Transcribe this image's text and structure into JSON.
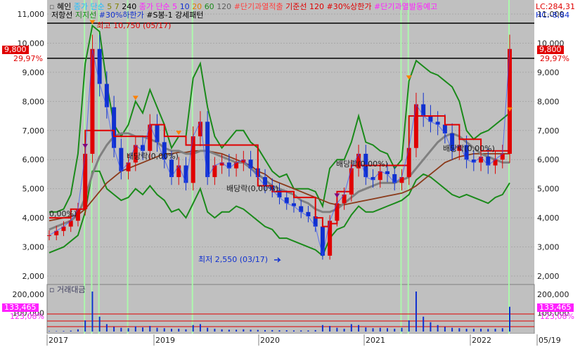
{
  "colors": {
    "plot_bg": "#c0c0c0",
    "main_line": "#e00000",
    "band": "#1a8a1a",
    "ma_slow": "#8b3a1a",
    "ma_gray": "#808080",
    "candle_up": "#e00000",
    "candle_down": "#1030d0",
    "volume_bar": "#1030d0",
    "price_tag": "#e00000",
    "volume_tag": "#ff20ff",
    "highlight_line": "#aaffaa",
    "resistance": "#000000"
  },
  "header": {
    "name": "혜인",
    "ma_prefix": "종가 단순",
    "ma_periods": [
      "5",
      "7",
      "240"
    ],
    "ma2_prefix": "종가 단순 5",
    "ma2_periods": [
      "10",
      "20",
      "60",
      "120"
    ],
    "signal1": "#단기과열적출",
    "baseline": "기준선 120",
    "signal2": "#30%상한가",
    "signal3": "#단기과열발동예고",
    "lc": "LC:284,31",
    "hc": "HC:-8,84"
  },
  "header2": {
    "resistance": "저항선",
    "support": "지지선",
    "signal4": "#30%하한가",
    "signal5": "#S봉-1 강세패턴"
  },
  "price_tag": {
    "value": "9,800",
    "pct": "29,97%"
  },
  "volume_panel": {
    "title": "거래대금",
    "tag_value": "133,465",
    "tag_pct": "123,08%",
    "axis_ticks": [
      "200,000",
      "100,000"
    ]
  },
  "y_ticks": [
    "11,000",
    "10,000",
    "9,000",
    "8,000",
    "7,000",
    "6,000",
    "5,000",
    "4,000",
    "3,000",
    "2,000"
  ],
  "x_ticks": [
    "2017",
    "2019",
    "2020",
    "2021",
    "2022",
    "05/19"
  ],
  "annotations": {
    "high": "최고 10,750 (05/17)",
    "low": "최저 2,550 (03/17)",
    "div1": "배당락(0,00%)",
    "div2": "배당락(0,00%)",
    "div3": "배당락(0,00%)",
    "div4": "배당락(0,00%)",
    "div0": "0,00%)"
  },
  "chart_data": {
    "type": "line",
    "title": "혜인",
    "y_unit": "KRW",
    "ylim": [
      2000,
      11000
    ],
    "x": [
      "2017-01",
      "2017-02",
      "2017-03",
      "2017-04",
      "2017-05",
      "2017-06",
      "2017-07",
      "2017-08",
      "2017-09",
      "2017-10",
      "2017-11",
      "2017-12",
      "2018-01",
      "2018-02",
      "2018-03",
      "2018-04",
      "2018-05",
      "2018-06",
      "2018-07",
      "2018-08",
      "2018-09",
      "2018-10",
      "2018-11",
      "2018-12",
      "2019-01",
      "2019-02",
      "2019-03",
      "2019-04",
      "2019-05",
      "2019-06",
      "2019-07",
      "2019-08",
      "2019-09",
      "2019-10",
      "2019-11",
      "2019-12",
      "2020-01",
      "2020-02",
      "2020-03",
      "2020-04",
      "2020-05",
      "2020-06",
      "2020-07",
      "2020-08",
      "2020-09",
      "2020-10",
      "2020-11",
      "2020-12",
      "2021-01",
      "2021-02",
      "2021-03",
      "2021-04",
      "2021-05",
      "2021-06",
      "2021-07",
      "2021-08",
      "2021-09",
      "2021-10",
      "2021-11",
      "2021-12",
      "2022-01",
      "2022-02",
      "2022-03",
      "2022-04",
      "2022-05"
    ],
    "series": [
      {
        "name": "종가",
        "values": [
          3400,
          3550,
          3700,
          3900,
          4300,
          6200,
          9800,
          8600,
          7800,
          6400,
          5600,
          5900,
          6500,
          6300,
          7200,
          6600,
          6000,
          5400,
          5800,
          5200,
          6800,
          7300,
          5400,
          5800,
          5900,
          5700,
          5900,
          6000,
          5700,
          5400,
          5100,
          4950,
          4700,
          4500,
          4400,
          4200,
          4050,
          3700,
          2700,
          3900,
          4500,
          4800,
          5700,
          6200,
          5400,
          5300,
          5600,
          5500,
          5200,
          5400,
          6400,
          7900,
          7500,
          7300,
          7200,
          6900,
          6300,
          6500,
          6000,
          5900,
          6100,
          5800,
          6000,
          6200,
          9800
        ]
      },
      {
        "name": "ma_upper",
        "values": [
          4200,
          4200,
          4300,
          4800,
          6200,
          9300,
          10600,
          10400,
          8600,
          7200,
          6800,
          7200,
          8000,
          7600,
          8400,
          7800,
          7200,
          6400,
          6800,
          6800,
          8800,
          9300,
          7800,
          6800,
          6400,
          6700,
          7000,
          7000,
          6600,
          6400,
          6000,
          5600,
          5400,
          5500,
          5000,
          5000,
          5000,
          4900,
          4400,
          5700,
          6000,
          6000,
          6600,
          7500,
          6600,
          6500,
          6300,
          6200,
          5700,
          6000,
          8700,
          9400,
          9200,
          9000,
          8900,
          8700,
          8500,
          8000,
          7000,
          6700,
          6900,
          7000,
          7200,
          7400,
          7600
        ]
      },
      {
        "name": "ma_lower",
        "values": [
          2800,
          2900,
          3000,
          3200,
          3400,
          4200,
          5600,
          5600,
          5000,
          4800,
          4600,
          4700,
          5000,
          4800,
          5100,
          4800,
          4600,
          4200,
          4300,
          4000,
          4500,
          5000,
          4200,
          4000,
          4200,
          4200,
          4400,
          4300,
          4100,
          3900,
          3700,
          3600,
          3300,
          3300,
          3200,
          3100,
          3000,
          2900,
          2700,
          3300,
          3600,
          3700,
          4100,
          4400,
          4200,
          4200,
          4300,
          4400,
          4500,
          4600,
          4800,
          5300,
          5500,
          5400,
          5200,
          5000,
          4800,
          4700,
          4800,
          4700,
          4600,
          4500,
          4700,
          4800,
          5200
        ]
      },
      {
        "name": "ma_gray",
        "values": [
          3600,
          3700,
          3800,
          3900,
          4100,
          4700,
          5500,
          6100,
          6500,
          6800,
          6900,
          6900,
          6800,
          6800,
          6700,
          6600,
          6400,
          6300,
          6300,
          6200,
          6200,
          6300,
          6300,
          6200,
          6100,
          6000,
          5900,
          5900,
          5700,
          5500,
          5300,
          5100,
          5000,
          4900,
          4800,
          4600,
          4500,
          4300,
          4200,
          4200,
          4300,
          4500,
          4700,
          4900,
          5000,
          5100,
          5200,
          5200,
          5200,
          5300,
          5400,
          5700,
          6000,
          6300,
          6600,
          6800,
          6900,
          6800,
          6600,
          6400,
          6200,
          6100,
          6000,
          5900,
          5900
        ]
      },
      {
        "name": "ma_slow",
        "values": [
          3900,
          3950,
          4000,
          4050,
          4100,
          4300,
          4600,
          4900,
          5200,
          5400,
          5600,
          5700,
          5800,
          5900,
          6000,
          6100,
          6200,
          6200,
          6250,
          6250,
          6300,
          6300,
          6300,
          6250,
          6200,
          6100,
          6000,
          5900,
          5800,
          5600,
          5500,
          5300,
          5200,
          5100,
          5000,
          4900,
          4800,
          4700,
          4600,
          4500,
          4450,
          4450,
          4500,
          4550,
          4600,
          4650,
          4700,
          4750,
          4800,
          4850,
          4950,
          5100,
          5300,
          5500,
          5700,
          5900,
          6000,
          6100,
          6150,
          6200,
          6200,
          6200,
          6200,
          6200,
          6200
        ]
      },
      {
        "name": "저항선",
        "values": [
          4000,
          4000,
          4000,
          4300,
          4300,
          7000,
          7000,
          7000,
          7000,
          6800,
          6800,
          6800,
          6800,
          6800,
          7200,
          7200,
          6800,
          6800,
          6800,
          6500,
          6500,
          6500,
          6500,
          6500,
          6500,
          6500,
          6500,
          6500,
          6500,
          5100,
          5100,
          4900,
          4900,
          4900,
          4700,
          4700,
          4700,
          4000,
          3700,
          3800,
          4900,
          4900,
          5800,
          5800,
          5800,
          5800,
          5800,
          5800,
          5800,
          5800,
          7500,
          7500,
          7500,
          7500,
          7500,
          7200,
          7200,
          6700,
          6700,
          6700,
          6300,
          6300,
          6300,
          6300,
          7200
        ]
      }
    ],
    "volume": [
      2,
      2,
      3,
      5,
      12,
      60,
      215,
      80,
      40,
      25,
      20,
      18,
      28,
      22,
      30,
      20,
      18,
      15,
      15,
      12,
      35,
      40,
      20,
      15,
      12,
      10,
      10,
      12,
      10,
      9,
      8,
      8,
      7,
      7,
      6,
      6,
      6,
      8,
      35,
      30,
      20,
      15,
      40,
      35,
      22,
      18,
      20,
      18,
      15,
      20,
      60,
      215,
      80,
      50,
      35,
      25,
      20,
      18,
      15,
      15,
      15,
      14,
      15,
      18,
      133
    ]
  }
}
